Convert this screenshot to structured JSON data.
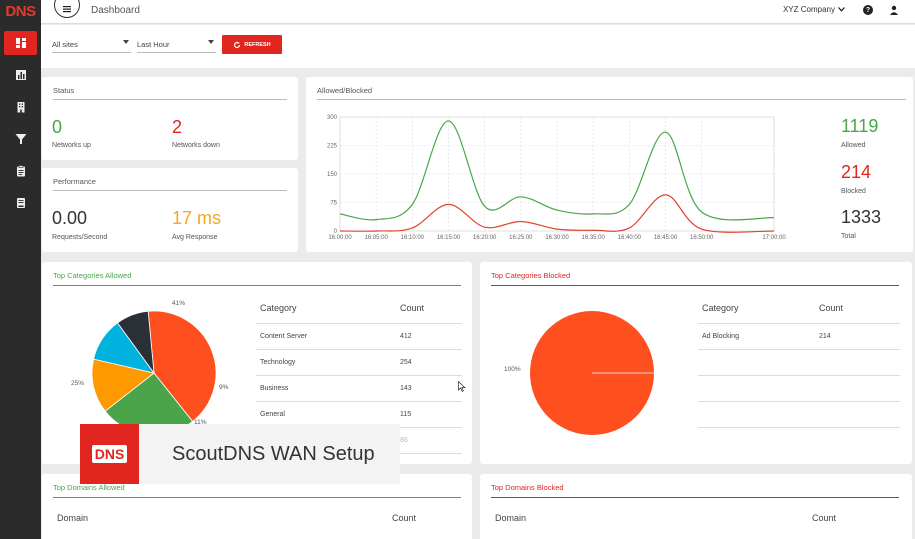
{
  "brand": {
    "logo": "DNS"
  },
  "rail": [
    "dashboard-icon",
    "bar-chart-icon",
    "building-icon",
    "filter-icon",
    "clipboard-icon",
    "book-icon"
  ],
  "topbar": {
    "title": "Dashboard",
    "company": "XYZ Company",
    "help": "?"
  },
  "filters": {
    "site": "All sites",
    "range": "Last Hour",
    "refresh": "REFRESH"
  },
  "status": {
    "title": "Status",
    "up_value": "0",
    "up_label": "Networks up",
    "down_value": "2",
    "down_label": "Networks down"
  },
  "performance": {
    "title": "Performance",
    "rps_value": "0.00",
    "rps_label": "Requests/Second",
    "avg_value": "17 ms",
    "avg_label": "Avg Response"
  },
  "allowed_blocked": {
    "title": "Allowed/Blocked",
    "allowed_value": "1119",
    "allowed_label": "Allowed",
    "blocked_value": "214",
    "blocked_label": "Blocked",
    "total_value": "1333",
    "total_label": "Total"
  },
  "chart_data": {
    "type": "line",
    "title": "",
    "xlabel": "",
    "ylabel": "",
    "ylim": [
      0,
      300
    ],
    "yticks": [
      "0",
      "75",
      "150",
      "225",
      "300"
    ],
    "x": [
      "16:00:00",
      "16:05:00",
      "16:10:00",
      "16:15:00",
      "16:20:00",
      "16:25:00",
      "16:30:00",
      "16:35:00",
      "16:40:00",
      "16:45:00",
      "16:50:00",
      "17:00:00"
    ],
    "series": [
      {
        "values": [
          45,
          30,
          70,
          290,
          65,
          90,
          55,
          45,
          70,
          260,
          50,
          35
        ],
        "color": "#4aa54a"
      },
      {
        "values": [
          0,
          0,
          8,
          70,
          10,
          25,
          5,
          2,
          8,
          95,
          5,
          0
        ],
        "color": "#e0442c"
      }
    ]
  },
  "top_allowed": {
    "title": "Top Categories Allowed",
    "col_category": "Category",
    "col_count": "Count",
    "rows": [
      {
        "category": "Content Server",
        "count": "412"
      },
      {
        "category": "Technology",
        "count": "254"
      },
      {
        "category": "Business",
        "count": "143"
      },
      {
        "category": "General",
        "count": "115"
      },
      {
        "category": "",
        "count": "86"
      }
    ],
    "pie_labels": {
      "p41": "41%",
      "p25": "25%",
      "p9": "9%",
      "p11": "11%"
    },
    "pie_colors": [
      "#fe4f1f",
      "#4aa54a",
      "#fe9a00",
      "#00b2dd",
      "#2b2f36"
    ]
  },
  "top_blocked": {
    "title": "Top Categories Blocked",
    "col_category": "Category",
    "col_count": "Count",
    "rows": [
      {
        "category": "Ad Blocking",
        "count": "214"
      }
    ],
    "pie_label": "100%"
  },
  "domains_allowed": {
    "title": "Top Domains Allowed",
    "col_domain": "Domain",
    "col_count": "Count"
  },
  "domains_blocked": {
    "title": "Top Domains Blocked",
    "col_domain": "Domain",
    "col_count": "Count"
  },
  "overlay": {
    "logo": "DNS",
    "title": "ScoutDNS WAN Setup"
  }
}
